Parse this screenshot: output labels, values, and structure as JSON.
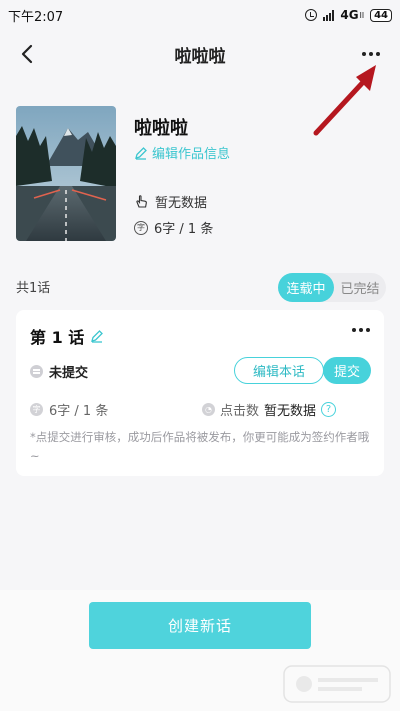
{
  "status_bar": {
    "time": "下午2:07",
    "network": "4G",
    "network_sub": "ll",
    "battery": "44"
  },
  "nav": {
    "title": "啦啦啦"
  },
  "work": {
    "title": "啦啦啦",
    "edit_info_label": "编辑作品信息",
    "likes_text": "暂无数据",
    "count_text": "6字 / 1 条"
  },
  "chapters_header": {
    "total_label": "共1话",
    "status_options": [
      "连载中",
      "已完结"
    ],
    "selected_status": "连载中"
  },
  "chapter": {
    "title": "第 1 话",
    "status": "未提交",
    "edit_button": "编辑本话",
    "submit_button": "提交",
    "count_text": "6字 / 1 条",
    "clicks_label": "点击数",
    "clicks_value": "暂无数据",
    "note": "*点提交进行审核，成功后作品将被发布，你更可能成为签约作者哦~"
  },
  "bottom": {
    "create_button": "创建新话"
  },
  "colors": {
    "accent": "#47d2db",
    "annotation_arrow": "#b5171f"
  },
  "icons": {
    "back": "back-arrow-icon",
    "more": "more-dots-icon",
    "edit": "pencil-icon",
    "like": "hand-pointer-icon",
    "count": "char-count-icon",
    "help": "question-icon"
  }
}
